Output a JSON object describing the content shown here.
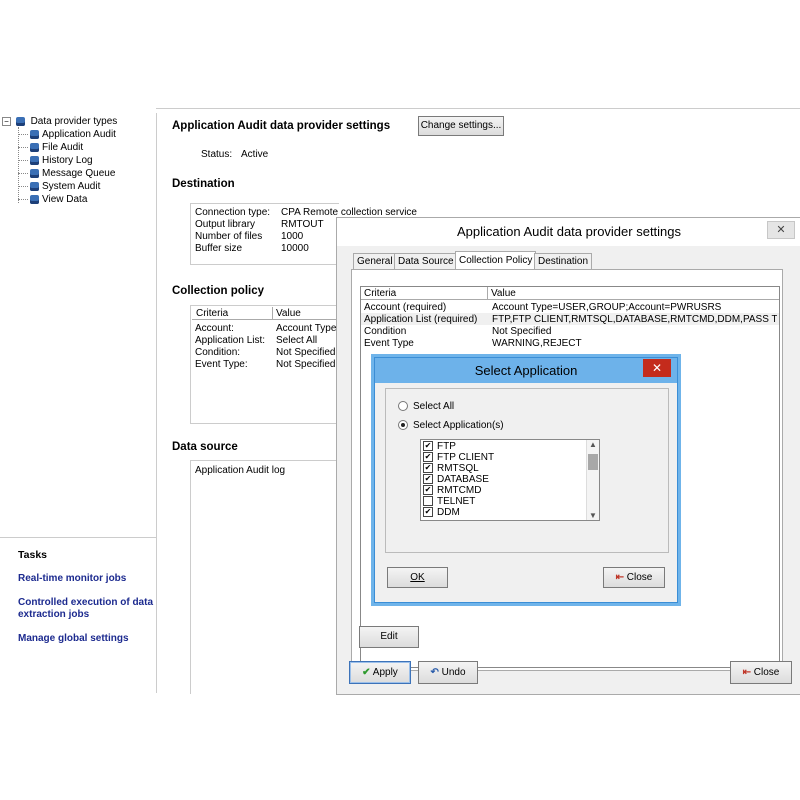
{
  "tree": {
    "root": "Data provider types",
    "items": [
      "Application Audit",
      "File Audit",
      "History Log",
      "Message Queue",
      "System Audit",
      "View Data"
    ]
  },
  "tasks": {
    "title": "Tasks",
    "links": [
      "Real-time monitor jobs",
      "Controlled execution of data extraction jobs",
      "Manage global settings"
    ]
  },
  "main": {
    "title": "Application Audit data provider settings",
    "change_button": "Change settings...",
    "status_label": "Status:",
    "status_value": "Active",
    "destination": {
      "heading": "Destination",
      "rows": [
        {
          "label": "Connection type:",
          "value": "CPA Remote collection service"
        },
        {
          "label": "Output library",
          "value": "RMTOUT"
        },
        {
          "label": "Number of files",
          "value": "1000"
        },
        {
          "label": "Buffer size",
          "value": "10000"
        }
      ]
    },
    "collection_policy": {
      "heading": "Collection policy",
      "col_criteria": "Criteria",
      "col_value": "Value",
      "rows": [
        {
          "criteria": "Account:",
          "value": "Account Type="
        },
        {
          "criteria": "Application List:",
          "value": "Select All"
        },
        {
          "criteria": "Condition:",
          "value": "Not Specified"
        },
        {
          "criteria": "Event Type:",
          "value": "Not Specified"
        }
      ]
    },
    "data_source": {
      "heading": "Data source",
      "value": "Application Audit log"
    }
  },
  "dialog": {
    "title": "Application Audit data provider settings",
    "close_glyph": "✕",
    "tabs": [
      "General",
      "Data Source",
      "Collection Policy",
      "Destination"
    ],
    "active_tab": "Collection Policy",
    "grid": {
      "col_criteria": "Criteria",
      "col_value": "Value",
      "rows": [
        {
          "criteria": "Account  (required)",
          "value": "Account Type=USER,GROUP;Account=PWRUSRS"
        },
        {
          "criteria": "Application List  (required)",
          "value": "FTP,FTP CLIENT,RMTSQL,DATABASE,RMTCMD,DDM,PASS T..."
        },
        {
          "criteria": "Condition",
          "value": "Not Specified"
        },
        {
          "criteria": "Event Type",
          "value": "WARNING,REJECT"
        }
      ]
    },
    "edit_button": "Edit",
    "apply_button": "Apply",
    "undo_button": "Undo",
    "close_button": "Close"
  },
  "modal": {
    "title": "Select Application",
    "close_glyph": "✕",
    "option_all": "Select All",
    "option_selected": "Select Application(s)",
    "selected_option": "Select Application(s)",
    "apps": [
      {
        "name": "FTP",
        "checked": true
      },
      {
        "name": "FTP CLIENT",
        "checked": true
      },
      {
        "name": "RMTSQL",
        "checked": true
      },
      {
        "name": "DATABASE",
        "checked": true
      },
      {
        "name": "RMTCMD",
        "checked": true
      },
      {
        "name": "TELNET",
        "checked": false
      },
      {
        "name": "DDM",
        "checked": true
      }
    ],
    "ok_button": "OK",
    "close_button": "Close"
  }
}
